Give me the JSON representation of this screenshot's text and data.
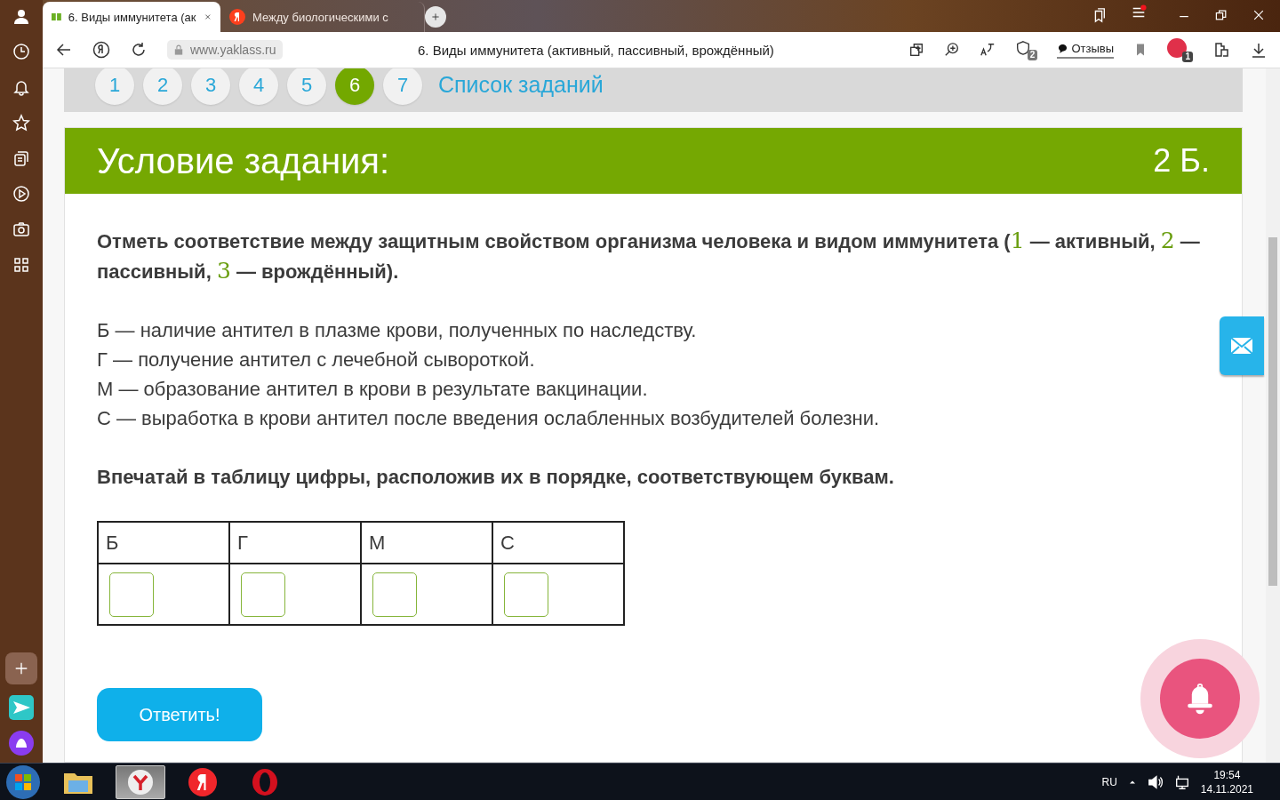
{
  "browser": {
    "tabs": [
      {
        "title": "6. Виды иммунитета (ак",
        "kind": "yaklass",
        "selected": true
      },
      {
        "title": "Между биологическими с",
        "kind": "yandex",
        "selected": false
      }
    ],
    "address": "www.yaklass.ru",
    "page_title": "6. Виды иммунитета (активный, пассивный, врождённый)",
    "shield_badge": "2",
    "reviews_label": "Отзывы",
    "adblock_badge": "1"
  },
  "task_nav": {
    "items": [
      {
        "label": "1",
        "selected": false
      },
      {
        "label": "2",
        "selected": false
      },
      {
        "label": "3",
        "selected": false
      },
      {
        "label": "4",
        "selected": false
      },
      {
        "label": "5",
        "selected": false
      },
      {
        "label": "6",
        "selected": true
      },
      {
        "label": "7",
        "selected": false
      }
    ],
    "list_link": "Список заданий"
  },
  "task": {
    "title": "Условие задания:",
    "points": "2 Б.",
    "question": [
      {
        "kind": "text",
        "text": "Отметь соответствие между защитным свойством организма человека и видом иммунитета ("
      },
      {
        "kind": "number",
        "text": "1"
      },
      {
        "kind": "text",
        "text": " — активный, "
      },
      {
        "kind": "number",
        "text": "2"
      },
      {
        "kind": "text",
        "text": " — пассивный, "
      },
      {
        "kind": "number",
        "text": "3"
      },
      {
        "kind": "text",
        "text": " — врождённый)."
      }
    ],
    "statements": [
      "Б — наличие антител в плазме крови, полученных по наследству.",
      "Г — получение антител с лечебной сывороткой.",
      "М — образование антител в крови в результате вакцинации.",
      "С — выработка в крови антител после введения ослабленных возбудителей болезни."
    ],
    "instruction": "Впечатай в таблицу цифры, расположив их в порядке, соответствующем буквам.",
    "table": {
      "columns": [
        "Б",
        "Г",
        "М",
        "С"
      ]
    },
    "submit": "Ответить!"
  },
  "taskbar": {
    "apps": [
      {
        "kind": "explorer",
        "selected": false
      },
      {
        "kind": "yabrowser",
        "selected": true
      },
      {
        "kind": "yandex",
        "selected": false
      },
      {
        "kind": "opera",
        "selected": false
      }
    ],
    "language": "RU",
    "time": "19:54",
    "date": "14.11.2021"
  }
}
